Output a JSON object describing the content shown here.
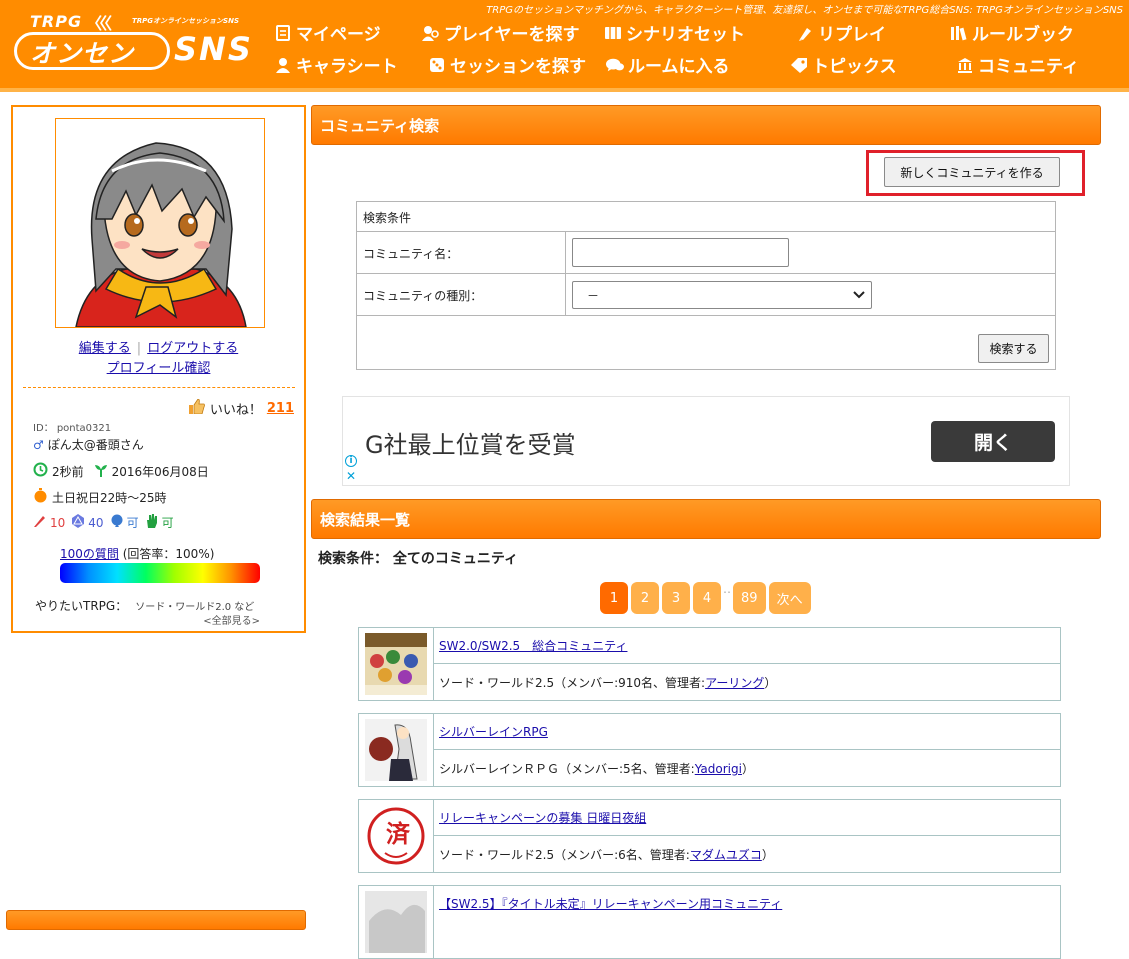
{
  "header": {
    "tagline": "TRPGのセッションマッチングから、キャラクターシート管理、友達探し、オンセまで可能なTRPG総合SNS: TRPGオンラインセッションSNS",
    "logo_top": "TRPG",
    "logo_waves": "〈〈〈",
    "logo_sub": "TRPGオンラインセッションSNS",
    "logo_main": "オンセン",
    "logo_sns": "SNS",
    "nav": [
      {
        "label": "マイページ",
        "icon": "mypage-icon"
      },
      {
        "label": "プレイヤーを探す",
        "icon": "player-search-icon"
      },
      {
        "label": "シナリオセット",
        "icon": "scenario-icon"
      },
      {
        "label": "リプレイ",
        "icon": "replay-icon"
      },
      {
        "label": "ルールブック",
        "icon": "rulebook-icon"
      },
      {
        "label": "キャラシート",
        "icon": "charasheet-icon"
      },
      {
        "label": "セッションを探す",
        "icon": "dice-icon"
      },
      {
        "label": "ルームに入る",
        "icon": "chat-icon"
      },
      {
        "label": "トピックス",
        "icon": "tag-icon"
      },
      {
        "label": "コミュニティ",
        "icon": "community-icon"
      }
    ]
  },
  "profile": {
    "edit_link": "編集する",
    "separator": "|",
    "logout_link": "ログアウトする",
    "profile_link": "プロフィール確認",
    "likes_label": "いいね！",
    "likes_count": "211",
    "user_id": "ID： ponta0321",
    "user_name": "ぽん太@番頭さん",
    "last_login": "2秒前",
    "registered": "2016年06月08日",
    "play_time": "土日祝日22時～25時",
    "stat_pen": "10",
    "stat_dice": "40",
    "stat_voice": "可",
    "stat_hand": "可",
    "questions_link": "100の質問",
    "answer_rate": "(回答率：100%)",
    "want_label": "やりたいTRPG：",
    "want_games": "ソード・ワールド2.0 など",
    "see_all": "<全部見る>",
    "colors": {
      "accent": "#ff8c00"
    }
  },
  "search": {
    "section_title": "コミュニティ検索",
    "create_button": "新しくコミュニティを作る",
    "conditions_label": "検索条件",
    "name_label": "コミュニティ名：",
    "name_value": "",
    "type_label": "コミュニティの種別：",
    "type_value": "－",
    "search_button": "検索する"
  },
  "ad": {
    "headline": "G社最上位賞を受賞",
    "open_button": "開く",
    "info_icon": "i",
    "close_icon": "✕"
  },
  "results": {
    "section_title": "検索結果一覧",
    "criteria_label": "検索条件：",
    "criteria_value": "全てのコミュニティ",
    "pages": [
      "1",
      "2",
      "3",
      "4"
    ],
    "page_dots": "‥",
    "last_page": "89",
    "next": "次へ",
    "items": [
      {
        "title": "SW2.0/SW2.5　総合コミュニティ",
        "meta_prefix": "ソード・ワールド2.5（メンバー:910名、管理者:",
        "admin": "アーリング",
        "meta_suffix": "）"
      },
      {
        "title": "シルバーレインRPG",
        "meta_prefix": "シルバーレインＲＰＧ（メンバー:5名、管理者:",
        "admin": "Yadorigi",
        "meta_suffix": "）"
      },
      {
        "title": "リレーキャンペーンの募集 日曜日夜組",
        "meta_prefix": "ソード・ワールド2.5（メンバー:6名、管理者:",
        "admin": "マダムユズコ",
        "meta_suffix": "）"
      },
      {
        "title": "【SW2.5】『タイトル未定』リレーキャンペーン用コミュニティ",
        "meta_prefix": "",
        "admin": "",
        "meta_suffix": ""
      }
    ]
  }
}
